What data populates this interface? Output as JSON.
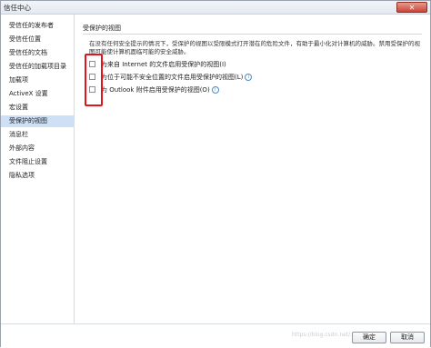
{
  "window": {
    "title": "信任中心",
    "close_glyph": "✕"
  },
  "sidebar": {
    "items": [
      {
        "label": "受信任的发布者",
        "selected": false
      },
      {
        "label": "受信任位置",
        "selected": false
      },
      {
        "label": "受信任的文档",
        "selected": false
      },
      {
        "label": "受信任的加载项目录",
        "selected": false
      },
      {
        "label": "加载项",
        "selected": false
      },
      {
        "label": "ActiveX 设置",
        "selected": false
      },
      {
        "label": "宏设置",
        "selected": false
      },
      {
        "label": "受保护的视图",
        "selected": true
      },
      {
        "label": "消息栏",
        "selected": false
      },
      {
        "label": "外部内容",
        "selected": false
      },
      {
        "label": "文件阻止设置",
        "selected": false
      },
      {
        "label": "隐私选项",
        "selected": false
      }
    ]
  },
  "main": {
    "section_title": "受保护的视图",
    "description": "在没有任何安全提示的情况下，受保护的视图以受限模式打开潜在的危险文件，有助于最小化对计算机的威胁。禁用受保护的视图可能使计算机面临可能的安全威胁。",
    "options": [
      {
        "label": "为来自 Internet 的文件启用受保护的视图(I)",
        "checked": false
      },
      {
        "label": "为位于可能不安全位置的文件启用受保护的视图(L)",
        "checked": false
      },
      {
        "label": "为 Outlook 附件启用受保护的视图(O)",
        "checked": false
      }
    ],
    "info_glyph": "i"
  },
  "footer": {
    "ok_label": "确定",
    "cancel_label": "取消"
  },
  "watermark": "https://blog.csdn.net/...",
  "colors": {
    "selected_bg": "#cde0f5",
    "highlight": "#e0141b",
    "close_button": "#c9453a"
  }
}
